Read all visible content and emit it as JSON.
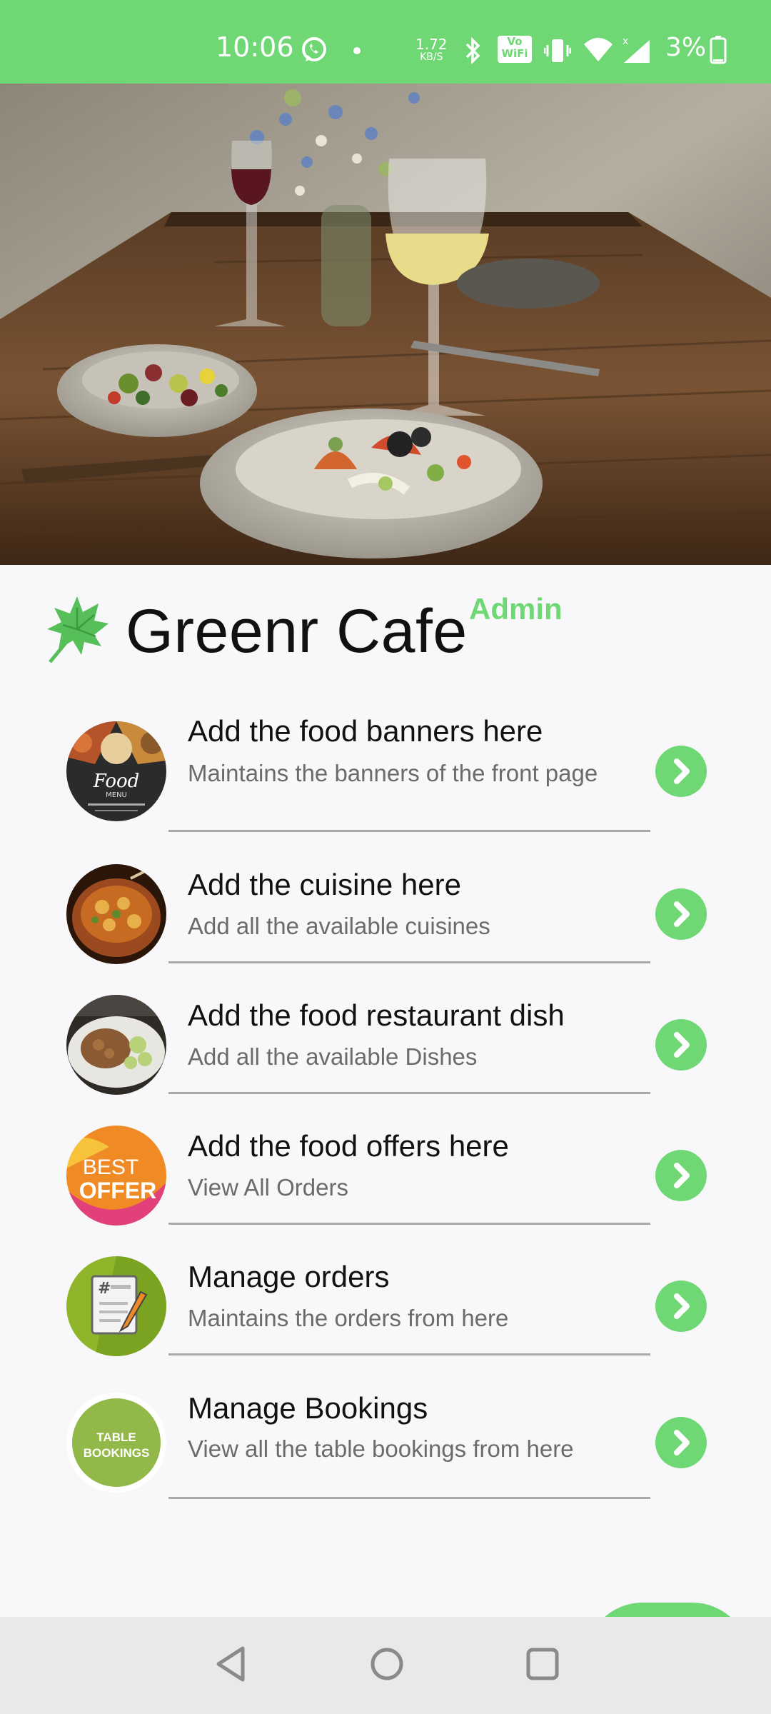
{
  "status_bar": {
    "time": "10:06",
    "speed_value": "1.72",
    "speed_unit": "KB/S",
    "volte_line1": "Vo",
    "volte_line2": "WiFi",
    "battery": "3%",
    "icons": [
      "whatsapp-icon",
      "dot-icon",
      "bluetooth-icon",
      "volte-wifi-icon",
      "vibrate-icon",
      "wifi-icon",
      "signal-icon",
      "battery-icon"
    ]
  },
  "hero": {
    "image": "restaurant-table-photo"
  },
  "header": {
    "title": "Greenr Cafe",
    "badge": "Admin",
    "accent_color": "#6fd874"
  },
  "menu": [
    {
      "title": "Add the food banners here",
      "subtitle": "Maintains the banners of the front page",
      "thumb": "food-menu-thumb"
    },
    {
      "title": "Add the cuisine here",
      "subtitle": "Add all the available cuisines",
      "thumb": "cuisine-thumb"
    },
    {
      "title": "Add the food restaurant dish",
      "subtitle": "Add all the available Dishes",
      "thumb": "dish-thumb"
    },
    {
      "title": "Add the food offers here",
      "subtitle": "View All Orders",
      "thumb": "best-offer-thumb",
      "thumb_text_1": "BEST",
      "thumb_text_2": "OFFER"
    },
    {
      "title": "Manage orders",
      "subtitle": "Maintains the orders from here",
      "thumb": "orders-thumb",
      "thumb_text_1": "#"
    },
    {
      "title": "Manage Bookings",
      "subtitle": "View all the table bookings from here",
      "thumb": "table-bookings-thumb",
      "thumb_text_1": "TABLE",
      "thumb_text_2": "BOOKINGS"
    }
  ],
  "nav": {
    "buttons": [
      "back",
      "home",
      "recents"
    ]
  }
}
